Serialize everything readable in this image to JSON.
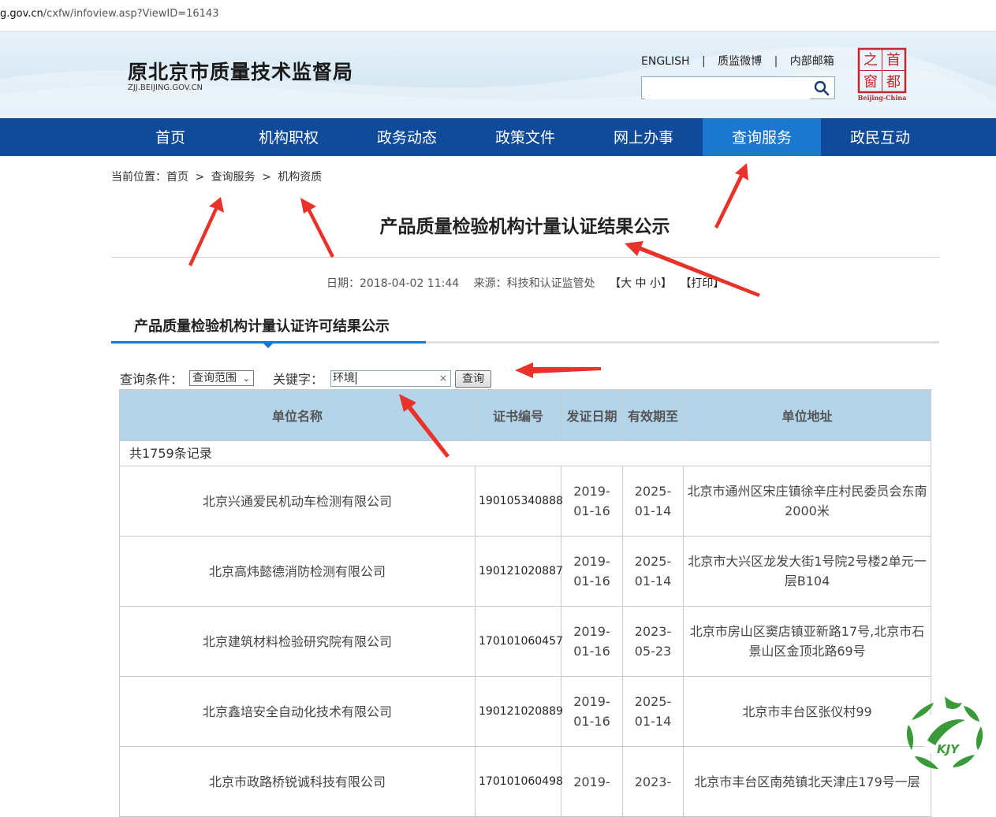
{
  "url": {
    "domain": "g.gov.cn",
    "path": "/cxfw/infoview.asp?ViewID=16143"
  },
  "site": {
    "title": "原北京市质量技术监督局",
    "subtitle": "ZJJ.BEIJING.GOV.CN"
  },
  "toplinks": [
    "ENGLISH",
    "|",
    "质监微博",
    "|",
    "内部邮箱"
  ],
  "seal": {
    "chars": [
      "首",
      "都",
      "之",
      "窗"
    ],
    "caption": "Beijing-China",
    "color": "#c0282d"
  },
  "nav": {
    "items": [
      "首页",
      "机构职权",
      "政务动态",
      "政策文件",
      "网上办事",
      "查询服务",
      "政民互动"
    ],
    "active_index": 5,
    "color": "#0f4b9a",
    "active_color": "#1c77d0"
  },
  "breadcrumb": {
    "label": "当前位置：",
    "items": [
      "首页",
      ">",
      "查询服务",
      ">",
      "机构资质"
    ]
  },
  "article": {
    "title": "产品质量检验机构计量认证结果公示",
    "date": "日期：2018-04-02 11:44",
    "source": "来源：科技和认证监管处",
    "font_sizes": "【大 中 小】",
    "print": "【打印】"
  },
  "section": {
    "title": "产品质量检验机构计量认证许可结果公示"
  },
  "query": {
    "condition_label": "查询条件：",
    "scope_value": "查询范围",
    "keyword_label": "关键字：",
    "keyword_value": "环境",
    "clear": "×",
    "button": "查询"
  },
  "table": {
    "headers": [
      "单位名称",
      "证书编号",
      "发证日期",
      "有效期至",
      "单位地址"
    ],
    "count": "共1759条记录",
    "rows": [
      {
        "name": "北京兴通爱民机动车检测有限公司",
        "cert": "190105340888",
        "issue": "2019-01-16",
        "expire": "2025-01-14",
        "address": "北京市通州区宋庄镇徐辛庄村民委员会东南2000米"
      },
      {
        "name": "北京高炜懿德消防检测有限公司",
        "cert": "190121020887",
        "issue": "2019-01-16",
        "expire": "2025-01-14",
        "address": "北京市大兴区龙发大街1号院2号楼2单元一层B104"
      },
      {
        "name": "北京建筑材料检验研究院有限公司",
        "cert": "170101060457",
        "issue": "2019-01-16",
        "expire": "2023-05-23",
        "address": "北京市房山区窦店镇亚新路17号,北京市石景山区金顶北路69号"
      },
      {
        "name": "北京鑫培安全自动化技术有限公司",
        "cert": "190121020889",
        "issue": "2019-01-16",
        "expire": "2025-01-14",
        "address": "北京市丰台区张仪村99"
      },
      {
        "name": "北京市政路桥锐诚科技有限公司",
        "cert": "170101060498",
        "issue": "2019-",
        "expire": "2023-",
        "address": "北京市丰台区南苑镇北天津庄179号一层"
      }
    ],
    "header_color": "#b4d4ea"
  },
  "watermark": {
    "text": "KJY",
    "color": "#3a9a3a"
  },
  "annotation_color": "#e8322a"
}
